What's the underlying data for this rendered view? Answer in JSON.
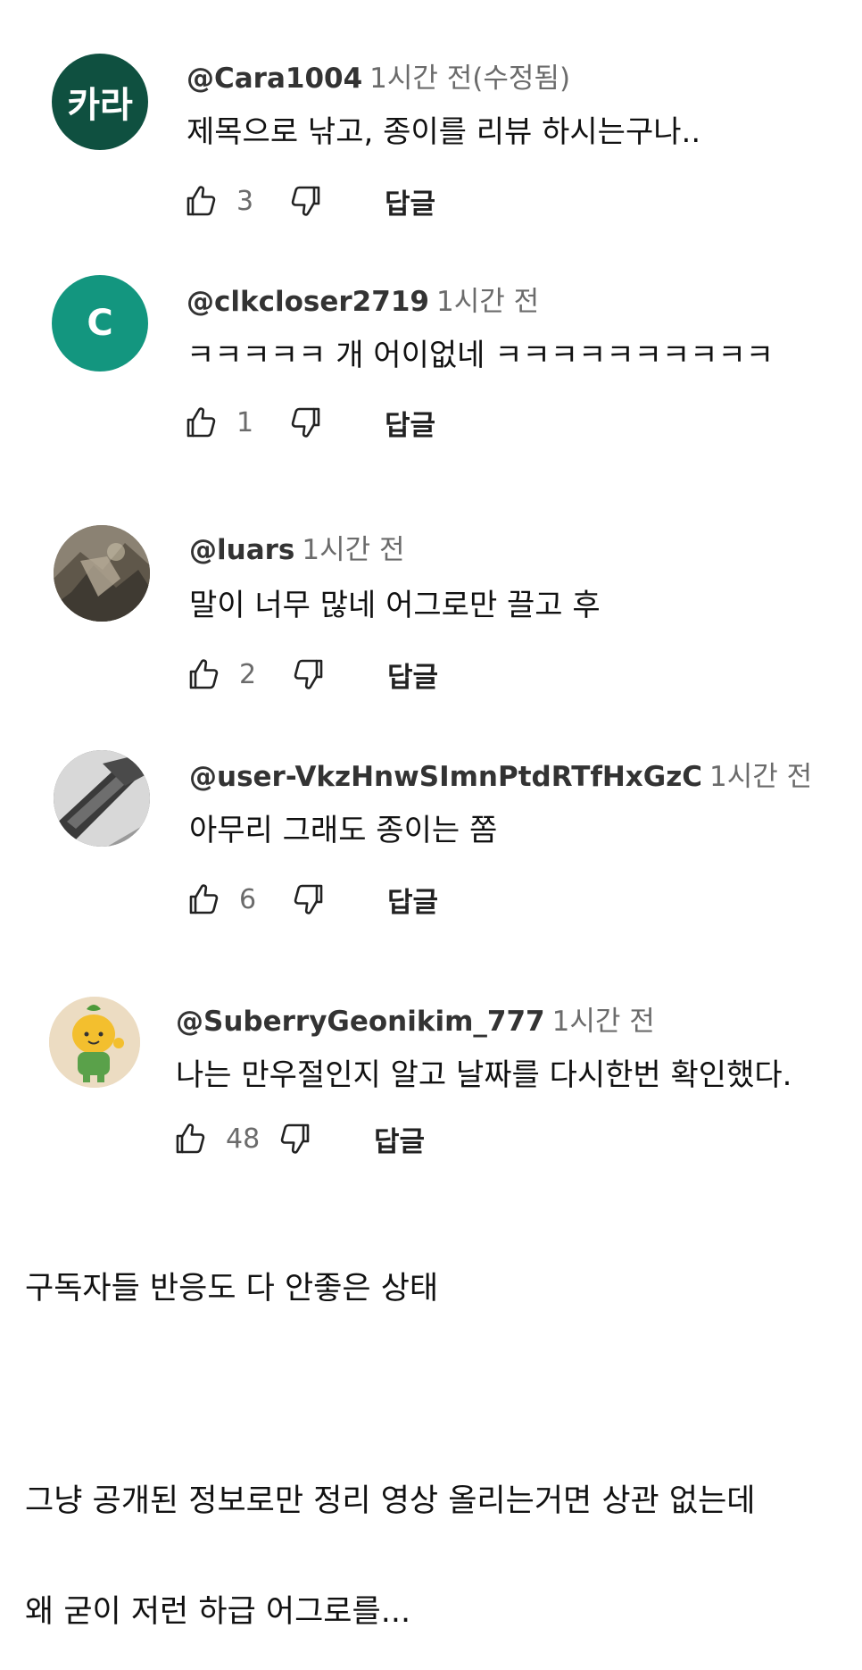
{
  "comments": [
    {
      "handle": "@Cara1004",
      "time": "1시간 전(수정됨)",
      "text": "제목으로 낚고, 종이를 리뷰 하시는구나..",
      "likes": "3",
      "reply_label": "답글",
      "avatar_label": "카라",
      "avatar_color": "#0f5040"
    },
    {
      "handle": "@clkcloser2719",
      "time": "1시간 전",
      "text": "ㅋㅋㅋㅋㅋ 개 어이없네 ㅋㅋㅋㅋㅋㅋㅋㅋㅋㅋ",
      "likes": "1",
      "reply_label": "답글",
      "avatar_label": "C",
      "avatar_color": "#13967f"
    },
    {
      "handle": "@luars",
      "time": "1시간 전",
      "text": "말이 너무 많네 어그로만 끌고 후",
      "likes": "2",
      "reply_label": "답글",
      "avatar_color": "#7e7564"
    },
    {
      "handle": "@user-VkzHnwSImnPtdRTfHxGzC",
      "time": "1시간 전",
      "text": "아무리 그래도 종이는 쫌",
      "likes": "6",
      "reply_label": "답글",
      "avatar_color": "#5c5c5c"
    },
    {
      "handle": "@SuberryGeonikim_777",
      "time": "1시간 전",
      "text": "나는 만우절인지 알고 날짜를 다시한번 확인했다.",
      "likes": "48",
      "reply_label": "답글",
      "avatar_color": "#ecdcc2"
    }
  ],
  "post": {
    "line1": "구독자들 반응도 다 안좋은 상태",
    "line2": "그냥 공개된 정보로만 정리 영상 올리는거면 상관 없는데",
    "line3": "왜 굳이 저런 하급 어그로를..."
  }
}
